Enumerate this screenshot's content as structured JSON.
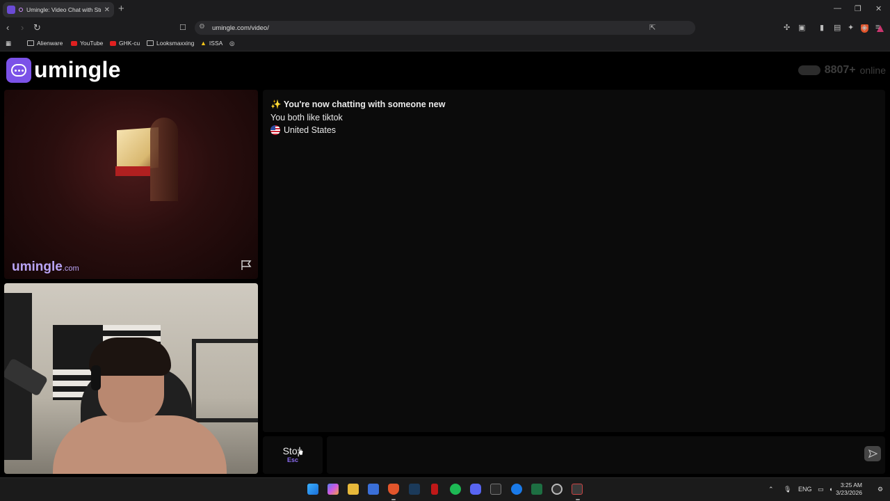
{
  "browser": {
    "tab_title": "Umingle: Video Chat with Str",
    "tab_close": "✕",
    "new_tab": "+",
    "window_controls": {
      "minimize": "—",
      "restore": "❐",
      "close": "✕"
    },
    "url": "umingle.com/video/",
    "bookmarks": [
      {
        "label": "Alienware",
        "icon": "folder-icon"
      },
      {
        "label": "YouTube",
        "icon": "youtube-icon"
      },
      {
        "label": "GHK-cu",
        "icon": "youtube-icon"
      },
      {
        "label": "Looksmaxxing",
        "icon": "folder-icon"
      },
      {
        "label": "ISSA",
        "icon": "warning-icon"
      }
    ]
  },
  "site": {
    "logo_text": "umingle",
    "online_count": "8807+",
    "online_label": "online",
    "watermark_brand": "umingle",
    "watermark_tld": ".com"
  },
  "chat": {
    "sparkle": "✨",
    "title": "You're now chatting with someone new",
    "interest": "You both like tiktok",
    "country": "United States"
  },
  "controls": {
    "stop_label": "Stop",
    "stop_key": "Esc",
    "message_placeholder": ""
  },
  "taskbar": {
    "lang": "ENG",
    "time": "3:25 AM",
    "date": "3/23/2026"
  },
  "colors": {
    "brand_purple": "#7b52e8",
    "accent_light_purple": "#b9a4f5",
    "page_bg": "#000000",
    "panel_bg": "#0b0b0b"
  }
}
